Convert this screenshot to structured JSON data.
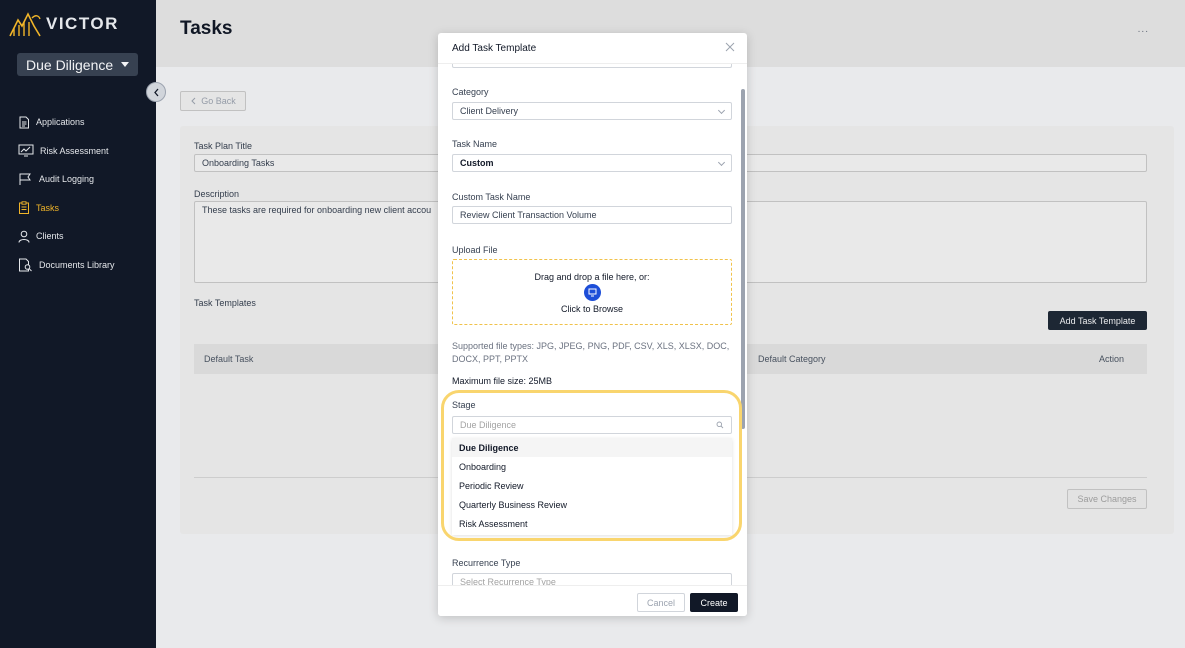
{
  "app": {
    "logo_text": "VICTOR",
    "stage_selector": "Due Diligence"
  },
  "sidebar": {
    "items": [
      {
        "label": "Applications",
        "icon": "document-icon",
        "active": false
      },
      {
        "label": "Risk Assessment",
        "icon": "chart-monitor-icon",
        "active": false
      },
      {
        "label": "Audit Logging",
        "icon": "flag-icon",
        "active": false
      },
      {
        "label": "Tasks",
        "icon": "clipboard-icon",
        "active": true
      },
      {
        "label": "Clients",
        "icon": "user-icon",
        "active": false
      },
      {
        "label": "Documents Library",
        "icon": "document-search-icon",
        "active": false
      }
    ]
  },
  "page": {
    "title": "Tasks",
    "kebab": "...",
    "go_back": "Go Back",
    "task_plan_title_label": "Task Plan Title",
    "task_plan_title_value": "Onboarding Tasks",
    "description_label": "Description",
    "description_value": "These tasks are required for onboarding new client accou",
    "task_templates_label": "Task Templates",
    "add_task_template_button": "Add Task Template",
    "table_headers": {
      "default_task": "Default Task",
      "default_category": "Default Category",
      "action": "Action"
    },
    "save_changes_button": "Save Changes"
  },
  "modal": {
    "title": "Add Task Template",
    "category_label": "Category",
    "category_value": "Client Delivery",
    "task_name_label": "Task Name",
    "task_name_value": "Custom",
    "custom_task_name_label": "Custom Task Name",
    "custom_task_name_value": "Review Client Transaction Volume",
    "upload_label": "Upload File",
    "dropzone_text": "Drag and drop a file here, or:",
    "dropzone_browse": "Click to Browse",
    "supported_types": "Supported file types: JPG, JPEG, PNG, PDF, CSV, XLS, XLSX, DOC, DOCX, PPT, PPTX",
    "max_size": "Maximum file size: 25MB",
    "stage_label": "Stage",
    "stage_placeholder": "Due Diligence",
    "stage_options": [
      "Due Diligence",
      "Onboarding",
      "Periodic Review",
      "Quarterly Business Review",
      "Risk Assessment"
    ],
    "stage_selected": "Due Diligence",
    "recurrence_label": "Recurrence Type",
    "recurrence_placeholder": "Select Recurrence Type",
    "cancel_button": "Cancel",
    "create_button": "Create"
  },
  "colors": {
    "sidebar_bg": "#111827",
    "active_nav": "#f0b429",
    "highlight": "#f9d56e",
    "primary_button": "#111827",
    "upload_icon": "#1d4ed8"
  }
}
